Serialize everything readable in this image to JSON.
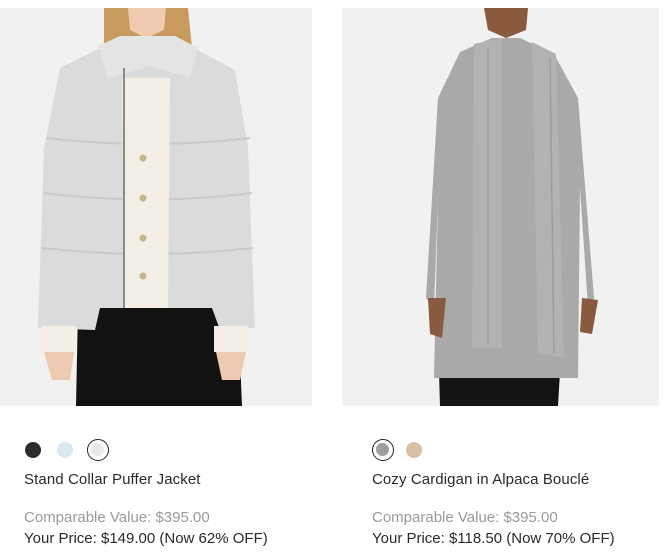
{
  "products": [
    {
      "name": "Stand Collar Puffer Jacket",
      "comparable_value": "Comparable Value: $395.00",
      "your_price": "Your Price: $149.00 (Now 62% OFF)",
      "swatches": [
        {
          "color": "#2b2b2b",
          "selected": false
        },
        {
          "color": "#dce8f0",
          "selected": false
        },
        {
          "color": "#e8e8e6",
          "selected": true
        }
      ]
    },
    {
      "name": "Cozy Cardigan in Alpaca Bouclé",
      "comparable_value": "Comparable Value: $395.00",
      "your_price": "Your Price: $118.50 (Now 70% OFF)",
      "swatches": [
        {
          "color": "#9e9e9e",
          "selected": true
        },
        {
          "color": "#d8bfa6",
          "selected": false
        }
      ]
    }
  ]
}
